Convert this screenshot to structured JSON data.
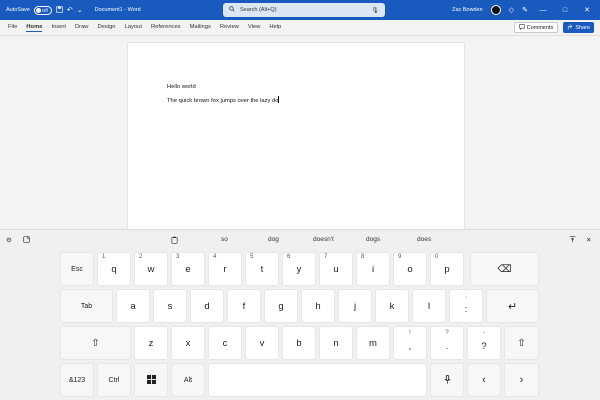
{
  "titlebar": {
    "autosave_label": "AutoSave",
    "autosave_state": "Off",
    "save_icon": "save-icon",
    "undo_icon": "undo-icon",
    "document_title": "Document1 - Word",
    "search_placeholder": "Search (Alt+Q)",
    "user_name": "Zac Bowden",
    "minimize": "—",
    "maximize": "□",
    "close": "✕"
  },
  "ribbon": {
    "tabs": [
      "File",
      "Home",
      "Insert",
      "Draw",
      "Design",
      "Layout",
      "References",
      "Mailings",
      "Review",
      "View",
      "Help"
    ],
    "active_tab": "Home",
    "comments_label": "Comments",
    "share_label": "Share"
  },
  "document": {
    "lines": [
      "Hello world",
      "The quick brown fox jumps over the lazy do"
    ]
  },
  "keyboard": {
    "suggestions": [
      "so",
      "dog",
      "doesn't",
      "dogs",
      "does"
    ],
    "row1": [
      {
        "label": "q",
        "num": "1"
      },
      {
        "label": "w",
        "num": "2"
      },
      {
        "label": "e",
        "num": "3"
      },
      {
        "label": "r",
        "num": "4"
      },
      {
        "label": "t",
        "num": "5"
      },
      {
        "label": "y",
        "num": "6"
      },
      {
        "label": "u",
        "num": "7"
      },
      {
        "label": "i",
        "num": "8"
      },
      {
        "label": "o",
        "num": "9"
      },
      {
        "label": "p",
        "num": "0"
      }
    ],
    "row2": [
      "a",
      "s",
      "d",
      "f",
      "g",
      "h",
      "j",
      "k",
      "l"
    ],
    "row3": [
      "z",
      "x",
      "c",
      "v",
      "b",
      "n",
      "m"
    ],
    "esc": "Esc",
    "tab": "Tab",
    "num_toggle": "&123",
    "ctrl": "Ctrl",
    "alt": "Alt",
    "backspace": "⌫",
    "enter": "↵",
    "shift": "⇧",
    "left": "‹",
    "right": "›",
    "colon_key": {
      "top": ";",
      "main": ":"
    },
    "apostrophe_key": {
      "top": "\"",
      "main": "'"
    },
    "comma_key": {
      "top": "!",
      "main": ","
    },
    "period_key": {
      "top": "?",
      "main": "."
    },
    "question_key": {
      "top": "-",
      "main": "?"
    }
  },
  "colors": {
    "title_bar": "#185abd",
    "key_bg": "#ffffff",
    "keyboard_bg": "#f0f0f0"
  }
}
